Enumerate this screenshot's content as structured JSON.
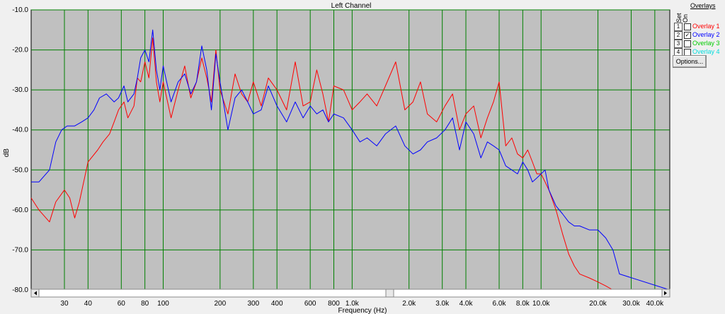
{
  "chart_data": {
    "type": "line",
    "title": "Left Channel",
    "xlabel": "Frequency (Hz)",
    "ylabel": "dB",
    "x_scale": "log",
    "xlim": [
      20,
      48000
    ],
    "ylim": [
      -80,
      -10
    ],
    "grid": true,
    "y_ticks": [
      -10,
      -20,
      -30,
      -40,
      -50,
      -60,
      -70,
      -80
    ],
    "y_tick_labels": [
      "-10.0",
      "-20.0",
      "-30.0",
      "-40.0",
      "-50.0",
      "-60.0",
      "-70.0",
      "-80.0"
    ],
    "x_ticks": [
      30,
      40,
      60,
      80,
      100,
      200,
      300,
      400,
      600,
      800,
      1000,
      2000,
      3000,
      4000,
      6000,
      8000,
      10000,
      20000,
      30000,
      40000
    ],
    "x_tick_labels": [
      "30",
      "40",
      "60",
      "80",
      "100",
      "200",
      "300",
      "400",
      "600",
      "800",
      "1.0k",
      "2.0k",
      "3.0k",
      "4.0k",
      "6.0k",
      "8.0k",
      "10.0k",
      "20.0k",
      "30.0k",
      "40.0k"
    ],
    "legend_position": "right",
    "series": [
      {
        "name": "Overlay 1",
        "color": "#ff0000",
        "x": [
          20,
          22,
          25,
          27,
          30,
          32,
          34,
          36,
          40,
          45,
          48,
          52,
          55,
          58,
          62,
          65,
          70,
          73,
          76,
          80,
          84,
          88,
          92,
          96,
          100,
          110,
          120,
          130,
          140,
          150,
          160,
          170,
          180,
          190,
          200,
          220,
          240,
          260,
          280,
          300,
          330,
          360,
          400,
          450,
          500,
          550,
          600,
          650,
          700,
          750,
          800,
          900,
          1000,
          1100,
          1200,
          1350,
          1500,
          1700,
          1900,
          2100,
          2300,
          2500,
          2800,
          3100,
          3400,
          3700,
          4000,
          4400,
          4800,
          5200,
          5600,
          6000,
          6500,
          7000,
          7500,
          8000,
          8500,
          9000,
          9500,
          10000,
          10500,
          11000,
          12000,
          13000,
          14000,
          15000,
          16000,
          18000,
          20000,
          22000,
          24000,
          25000,
          26000,
          48000
        ],
        "y": [
          -57,
          -60,
          -63,
          -58,
          -55,
          -57,
          -62,
          -58,
          -48,
          -45,
          -43,
          -41,
          -38,
          -35,
          -33,
          -37,
          -34,
          -27,
          -28,
          -23,
          -27,
          -17,
          -28,
          -33,
          -28,
          -37,
          -30,
          -24,
          -32,
          -28,
          -22,
          -27,
          -33,
          -20,
          -30,
          -36,
          -26,
          -31,
          -33,
          -28,
          -34,
          -27,
          -30,
          -35,
          -23,
          -34,
          -33,
          -25,
          -31,
          -38,
          -29,
          -30,
          -35,
          -33,
          -31,
          -34,
          -29,
          -23,
          -35,
          -33,
          -28,
          -36,
          -38,
          -34,
          -31,
          -40,
          -36,
          -34,
          -42,
          -37,
          -33,
          -28,
          -44,
          -42,
          -46,
          -47,
          -45,
          -48,
          -51,
          -51,
          -53,
          -55,
          -60,
          -66,
          -71,
          -74,
          -76,
          -77,
          -78,
          -79,
          -80,
          -80,
          -80,
          -80
        ]
      },
      {
        "name": "Overlay 2",
        "color": "#0000ff",
        "x": [
          20,
          22,
          25,
          27,
          29,
          31,
          34,
          37,
          40,
          43,
          46,
          50,
          55,
          58,
          62,
          65,
          70,
          73,
          76,
          80,
          84,
          88,
          92,
          96,
          100,
          110,
          120,
          130,
          140,
          150,
          160,
          170,
          180,
          190,
          200,
          220,
          240,
          260,
          280,
          300,
          330,
          360,
          400,
          450,
          500,
          550,
          600,
          650,
          700,
          750,
          800,
          900,
          1000,
          1100,
          1200,
          1350,
          1500,
          1700,
          1900,
          2100,
          2300,
          2500,
          2800,
          3100,
          3400,
          3700,
          4000,
          4400,
          4800,
          5200,
          5600,
          6000,
          6500,
          7000,
          7500,
          8000,
          8500,
          9000,
          9500,
          10000,
          10500,
          11000,
          12000,
          13000,
          14000,
          15000,
          16000,
          18000,
          20000,
          22000,
          24000,
          25000,
          26000,
          48000
        ],
        "y": [
          -53,
          -53,
          -50,
          -43,
          -40,
          -39,
          -39,
          -38,
          -37,
          -35,
          -32,
          -31,
          -33,
          -32,
          -29,
          -33,
          -31,
          -27,
          -22,
          -20,
          -23,
          -15,
          -25,
          -30,
          -24,
          -33,
          -28,
          -26,
          -31,
          -28,
          -19,
          -25,
          -35,
          -21,
          -28,
          -40,
          -32,
          -30,
          -33,
          -36,
          -35,
          -29,
          -34,
          -38,
          -33,
          -37,
          -34,
          -36,
          -35,
          -38,
          -36,
          -37,
          -40,
          -43,
          -42,
          -44,
          -41,
          -39,
          -44,
          -46,
          -45,
          -43,
          -42,
          -40,
          -37,
          -45,
          -38,
          -41,
          -47,
          -43,
          -44,
          -45,
          -49,
          -50,
          -51,
          -48,
          -50,
          -53,
          -52,
          -51,
          -50,
          -55,
          -59,
          -61,
          -63,
          -64,
          -64,
          -65,
          -65,
          -67,
          -70,
          -73,
          -76,
          -80
        ]
      }
    ]
  },
  "panel": {
    "overlays_title": "Overlays",
    "set_label": "Set",
    "on_label": "On",
    "overlays": [
      {
        "num": "1",
        "label": "Overlay 1",
        "checked": false,
        "color": "#ff0000"
      },
      {
        "num": "2",
        "label": "Overlay 2",
        "checked": true,
        "color": "#0000ff"
      },
      {
        "num": "3",
        "label": "Overlay 3",
        "checked": false,
        "color": "#00cc00"
      },
      {
        "num": "4",
        "label": "Overlay 4",
        "checked": false,
        "color": "#00dddd"
      }
    ],
    "options_label": "Options..."
  }
}
